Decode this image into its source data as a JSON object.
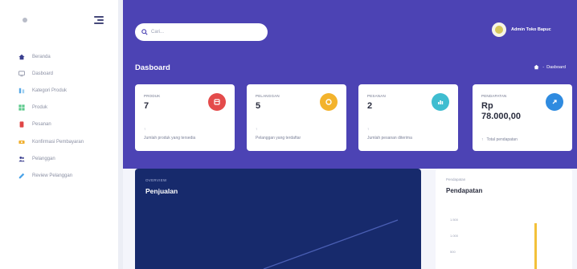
{
  "app": {
    "title": "Dashboard"
  },
  "sidebar": {
    "items": [
      {
        "label": "Beranda",
        "icon": "home-icon",
        "color": "#3b3f8f"
      },
      {
        "label": "Dasboard",
        "icon": "monitor-icon",
        "color": "#8a8fa3"
      },
      {
        "label": "Kategori Produk",
        "icon": "category-icon",
        "color": "#5aa9e6"
      },
      {
        "label": "Produk",
        "icon": "grid-icon",
        "color": "#5ac98a"
      },
      {
        "label": "Pesanan",
        "icon": "order-icon",
        "color": "#e04646"
      },
      {
        "label": "Konfirmasi Pembayaran",
        "icon": "money-icon",
        "color": "#f0b030"
      },
      {
        "label": "Pelanggan",
        "icon": "users-icon",
        "color": "#3b3f8f"
      },
      {
        "label": "Review Pelanggan",
        "icon": "review-icon",
        "color": "#4aa3e8"
      }
    ]
  },
  "header": {
    "search_placeholder": "Cari...",
    "user_name": "Admin Toko Bapuc",
    "page_title": "Dasboard",
    "breadcrumb": "Dasboard"
  },
  "cards": [
    {
      "label": "PRODUK",
      "value": "7",
      "sub": "Jumlah produk yang tersedia",
      "color": "#e44b4b",
      "icon": "box-icon"
    },
    {
      "label": "PELANGGAN",
      "value": "5",
      "sub": "Pelanggan yang terdaftar",
      "color": "#f3b32c",
      "icon": "star-icon"
    },
    {
      "label": "PESANAN",
      "value": "2",
      "sub": "Jumlah pesanan diterima",
      "color": "#3fbdd0",
      "icon": "chart-icon"
    },
    {
      "label": "PENDAPATAN",
      "value": "Rp\n78.000,00",
      "sub": "Total pendapatan",
      "color": "#2f8be0",
      "icon": "money-icon"
    }
  ],
  "panels": {
    "sales": {
      "caption": "OVERVIEW",
      "title": "Penjualan"
    },
    "income": {
      "caption": "Pendapatan",
      "title": "Pendapatan",
      "ticks": [
        "1.500",
        "1.000",
        "500"
      ]
    }
  },
  "colors": {
    "primary": "#4c43b4",
    "dark_panel": "#172a6c",
    "bar": "#f3c13a"
  }
}
